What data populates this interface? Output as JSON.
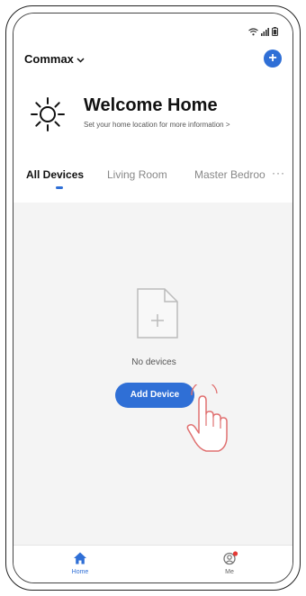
{
  "status_bar": {
    "icons": [
      "wifi-icon",
      "signal-icon",
      "battery-icon"
    ]
  },
  "header": {
    "home_name": "Commax",
    "add_home_label": "+"
  },
  "welcome": {
    "title": "Welcome Home",
    "subtitle": "Set your home location for more information >"
  },
  "tabs": {
    "items": [
      "All Devices",
      "Living Room",
      "Master Bedroo"
    ],
    "more": "···",
    "active_index": 0
  },
  "empty_state": {
    "message": "No devices",
    "button_label": "Add Device"
  },
  "bottom_nav": {
    "items": [
      {
        "label": "Home",
        "icon": "home-icon",
        "active": true
      },
      {
        "label": "Me",
        "icon": "profile-icon",
        "active": false
      }
    ]
  },
  "colors": {
    "accent": "#2f6fd6",
    "background": "#f4f4f4",
    "badge": "#e53935",
    "pointer": "#e07070"
  }
}
